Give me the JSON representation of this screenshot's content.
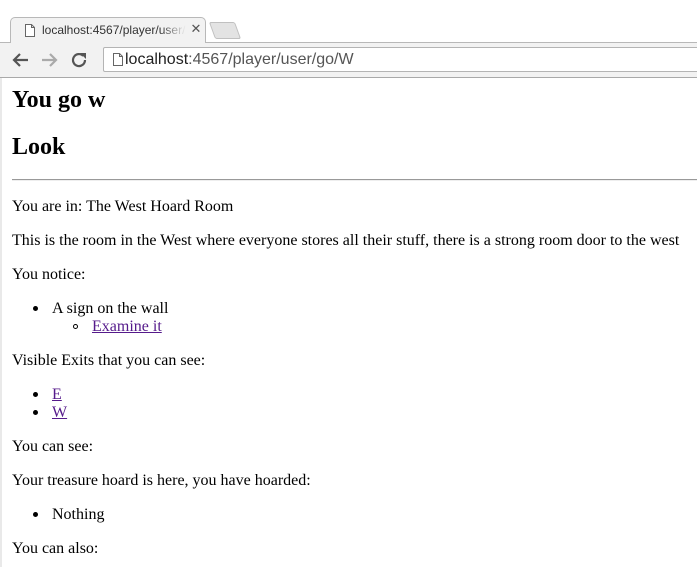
{
  "browser": {
    "tab": {
      "title": "localhost:4567/player/user/go/W",
      "close_glyph": "✕",
      "icon": "page-icon"
    },
    "new_tab_icon": "new-tab-icon",
    "nav": {
      "back_icon": "back-arrow-icon",
      "forward_icon": "forward-arrow-icon",
      "reload_icon": "reload-icon"
    },
    "address": {
      "host": "localhost",
      "rest": ":4567/player/user/go/W",
      "icon": "page-icon"
    }
  },
  "page": {
    "heading_go": "You go w",
    "heading_look": "Look",
    "location": "You are in: The West Hoard Room",
    "description": "This is the room in the West where everyone stores all their stuff, there is a strong room door to the west",
    "notice_label": "You notice:",
    "notices": [
      {
        "text": "A sign on the wall",
        "action": "Examine it"
      }
    ],
    "exits_label": "Visible Exits that you can see:",
    "exits": [
      "E",
      "W"
    ],
    "can_see_label": "You can see:",
    "hoard_label": "Your treasure hoard is here, you have hoarded:",
    "hoard_items": [
      "Nothing"
    ],
    "can_also_label": "You can also:"
  },
  "colors": {
    "visited_link": "#551a8b",
    "chrome_bg": "#f2f2f2",
    "text": "#000000"
  }
}
